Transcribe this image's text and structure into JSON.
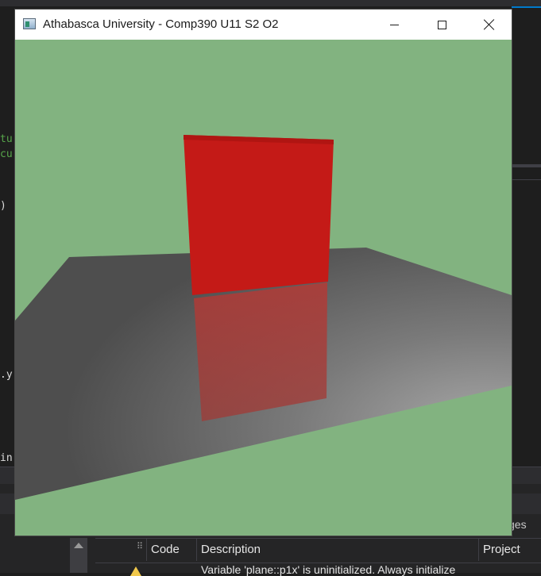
{
  "window": {
    "title": "Athabasca University - Comp390 U11 S2 O2",
    "icon": "app-window-icon",
    "controls": [
      "minimize-icon",
      "maximize-icon",
      "close-icon"
    ]
  },
  "scene": {
    "background_color": "#82b380",
    "cube_color": "#c41a17",
    "floor_color": "#6a6a6a",
    "description_elements": [
      "red-cube",
      "gray-floor-plane",
      "cube-reflection"
    ]
  },
  "ide": {
    "code_fragments": [
      "tu",
      "cu",
      ")",
      ".y",
      "in"
    ],
    "panel_tab_fragment": "ges",
    "error_list": {
      "columns": [
        "Code",
        "Description",
        "Project"
      ],
      "rows": [
        {
          "severity": "warning",
          "description": "Variable 'plane::p1x' is uninitialized. Always initialize"
        }
      ]
    }
  }
}
